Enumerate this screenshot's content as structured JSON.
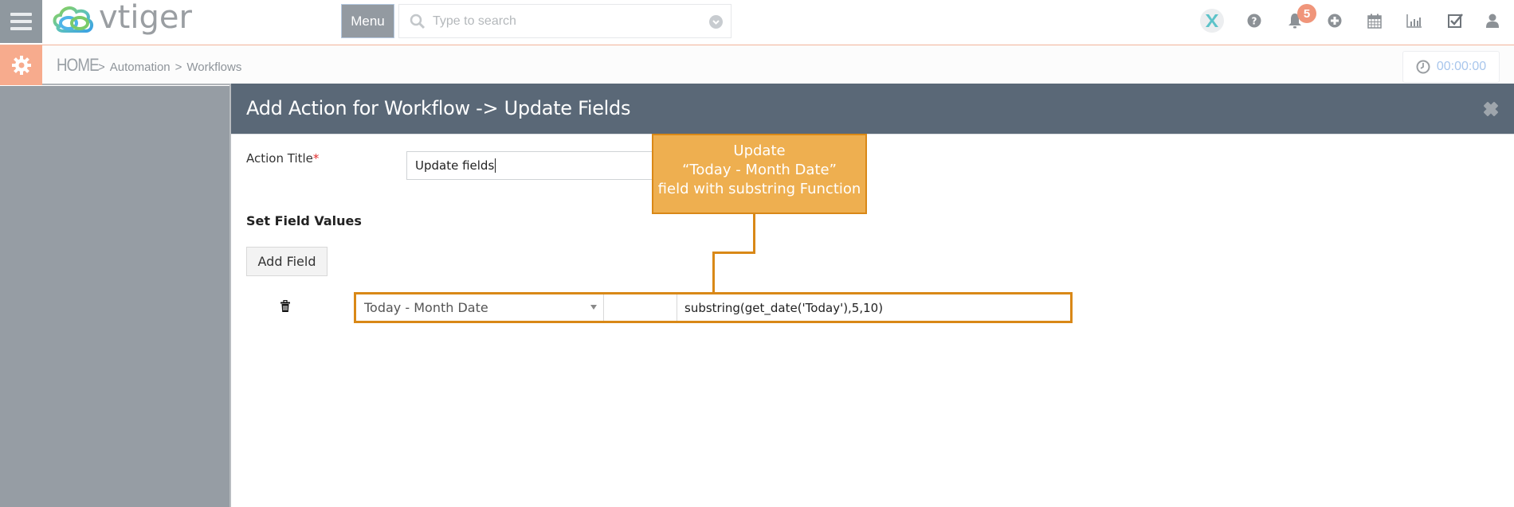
{
  "topbar": {
    "logo_text": "vtiger",
    "menu_label": "Menu",
    "search_placeholder": "Type to search",
    "notification_count": "5",
    "icons": [
      "hamburger-icon",
      "x-app-icon",
      "help-icon",
      "bell-icon",
      "plus-circle-icon",
      "calendar-icon",
      "bar-chart-icon",
      "checkbox-icon",
      "user-icon"
    ]
  },
  "subbar": {
    "breadcrumb": [
      {
        "label": "HOME"
      },
      {
        "label": "Automation"
      },
      {
        "label": "Workflows"
      }
    ],
    "separator": ">",
    "timer": "00:00:00"
  },
  "modal": {
    "title": "Add Action for Workflow -> Update Fields",
    "action_title_label": "Action Title",
    "required_mark": "*",
    "action_title_value": "Update fields",
    "section_title": "Set Field Values",
    "add_field_label": "Add Field",
    "field_rows": [
      {
        "field": "Today - Month Date",
        "operator": "",
        "value": "substring(get_date('Today'),5,10)"
      }
    ]
  },
  "callout": {
    "lines": [
      "Update",
      "“Today - Month Date”",
      "field with substring Function"
    ]
  },
  "colors": {
    "accent_orange": "#d98817",
    "callout_fill": "#eeaf50",
    "modal_header": "#5a6877",
    "settings_accent": "#f7ab8d",
    "badge": "#f0957a"
  }
}
